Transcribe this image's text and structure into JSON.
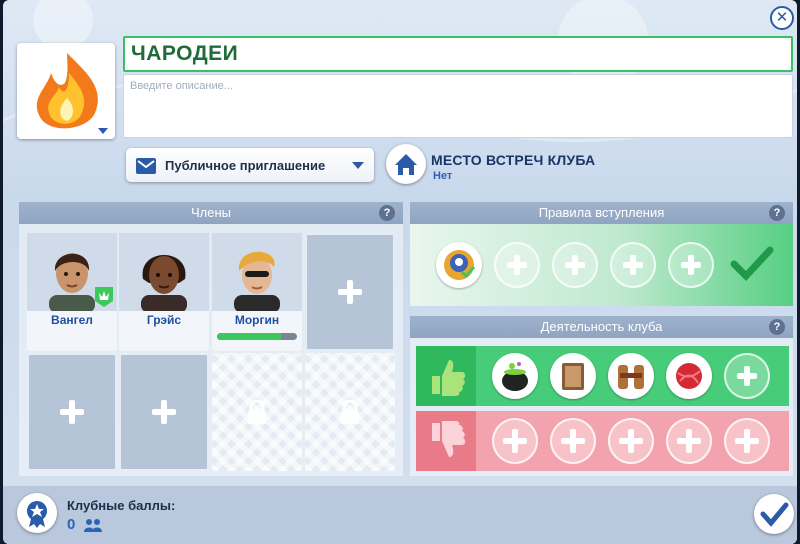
{
  "header": {
    "club_name": "ЧАРОДЕИ",
    "description_placeholder": "Введите описание...",
    "invite_type": "Публичное приглашение",
    "venue_title": "Место встреч клуба",
    "venue_value": "Нет"
  },
  "members_panel": {
    "title": "Члены",
    "help": "?",
    "members": [
      {
        "name": "Вангел",
        "leader": true
      },
      {
        "name": "Грэйс"
      },
      {
        "name": "Моргин",
        "progress": 0.8
      }
    ]
  },
  "rules_panel": {
    "title": "Правила вступления",
    "help": "?"
  },
  "activity_panel": {
    "title": "Деятельность клуба",
    "help": "?",
    "liked": [
      "cauldron-icon",
      "book-icon",
      "wood-icon",
      "yarn-icon"
    ],
    "disliked": []
  },
  "footer": {
    "points_label": "Клубные баллы:",
    "points_value": "0"
  },
  "colors": {
    "accent": "#2b5aa8",
    "green": "#47cc79",
    "pink": "#f3a3ad"
  }
}
